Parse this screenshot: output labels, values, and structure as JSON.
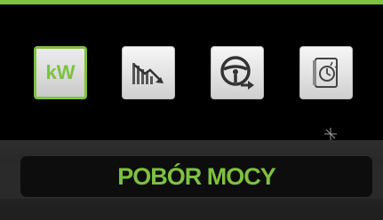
{
  "header": {
    "accent_color": "#7dc142"
  },
  "mode_buttons": [
    {
      "icon": "kw-icon",
      "label": "kW",
      "active": true
    },
    {
      "icon": "bar-chart-down-icon",
      "active": false
    },
    {
      "icon": "steering-wheel-icon",
      "active": false
    },
    {
      "icon": "clock-gauge-icon",
      "active": false
    }
  ],
  "panel": {
    "title": "POBÓR MOCY"
  }
}
